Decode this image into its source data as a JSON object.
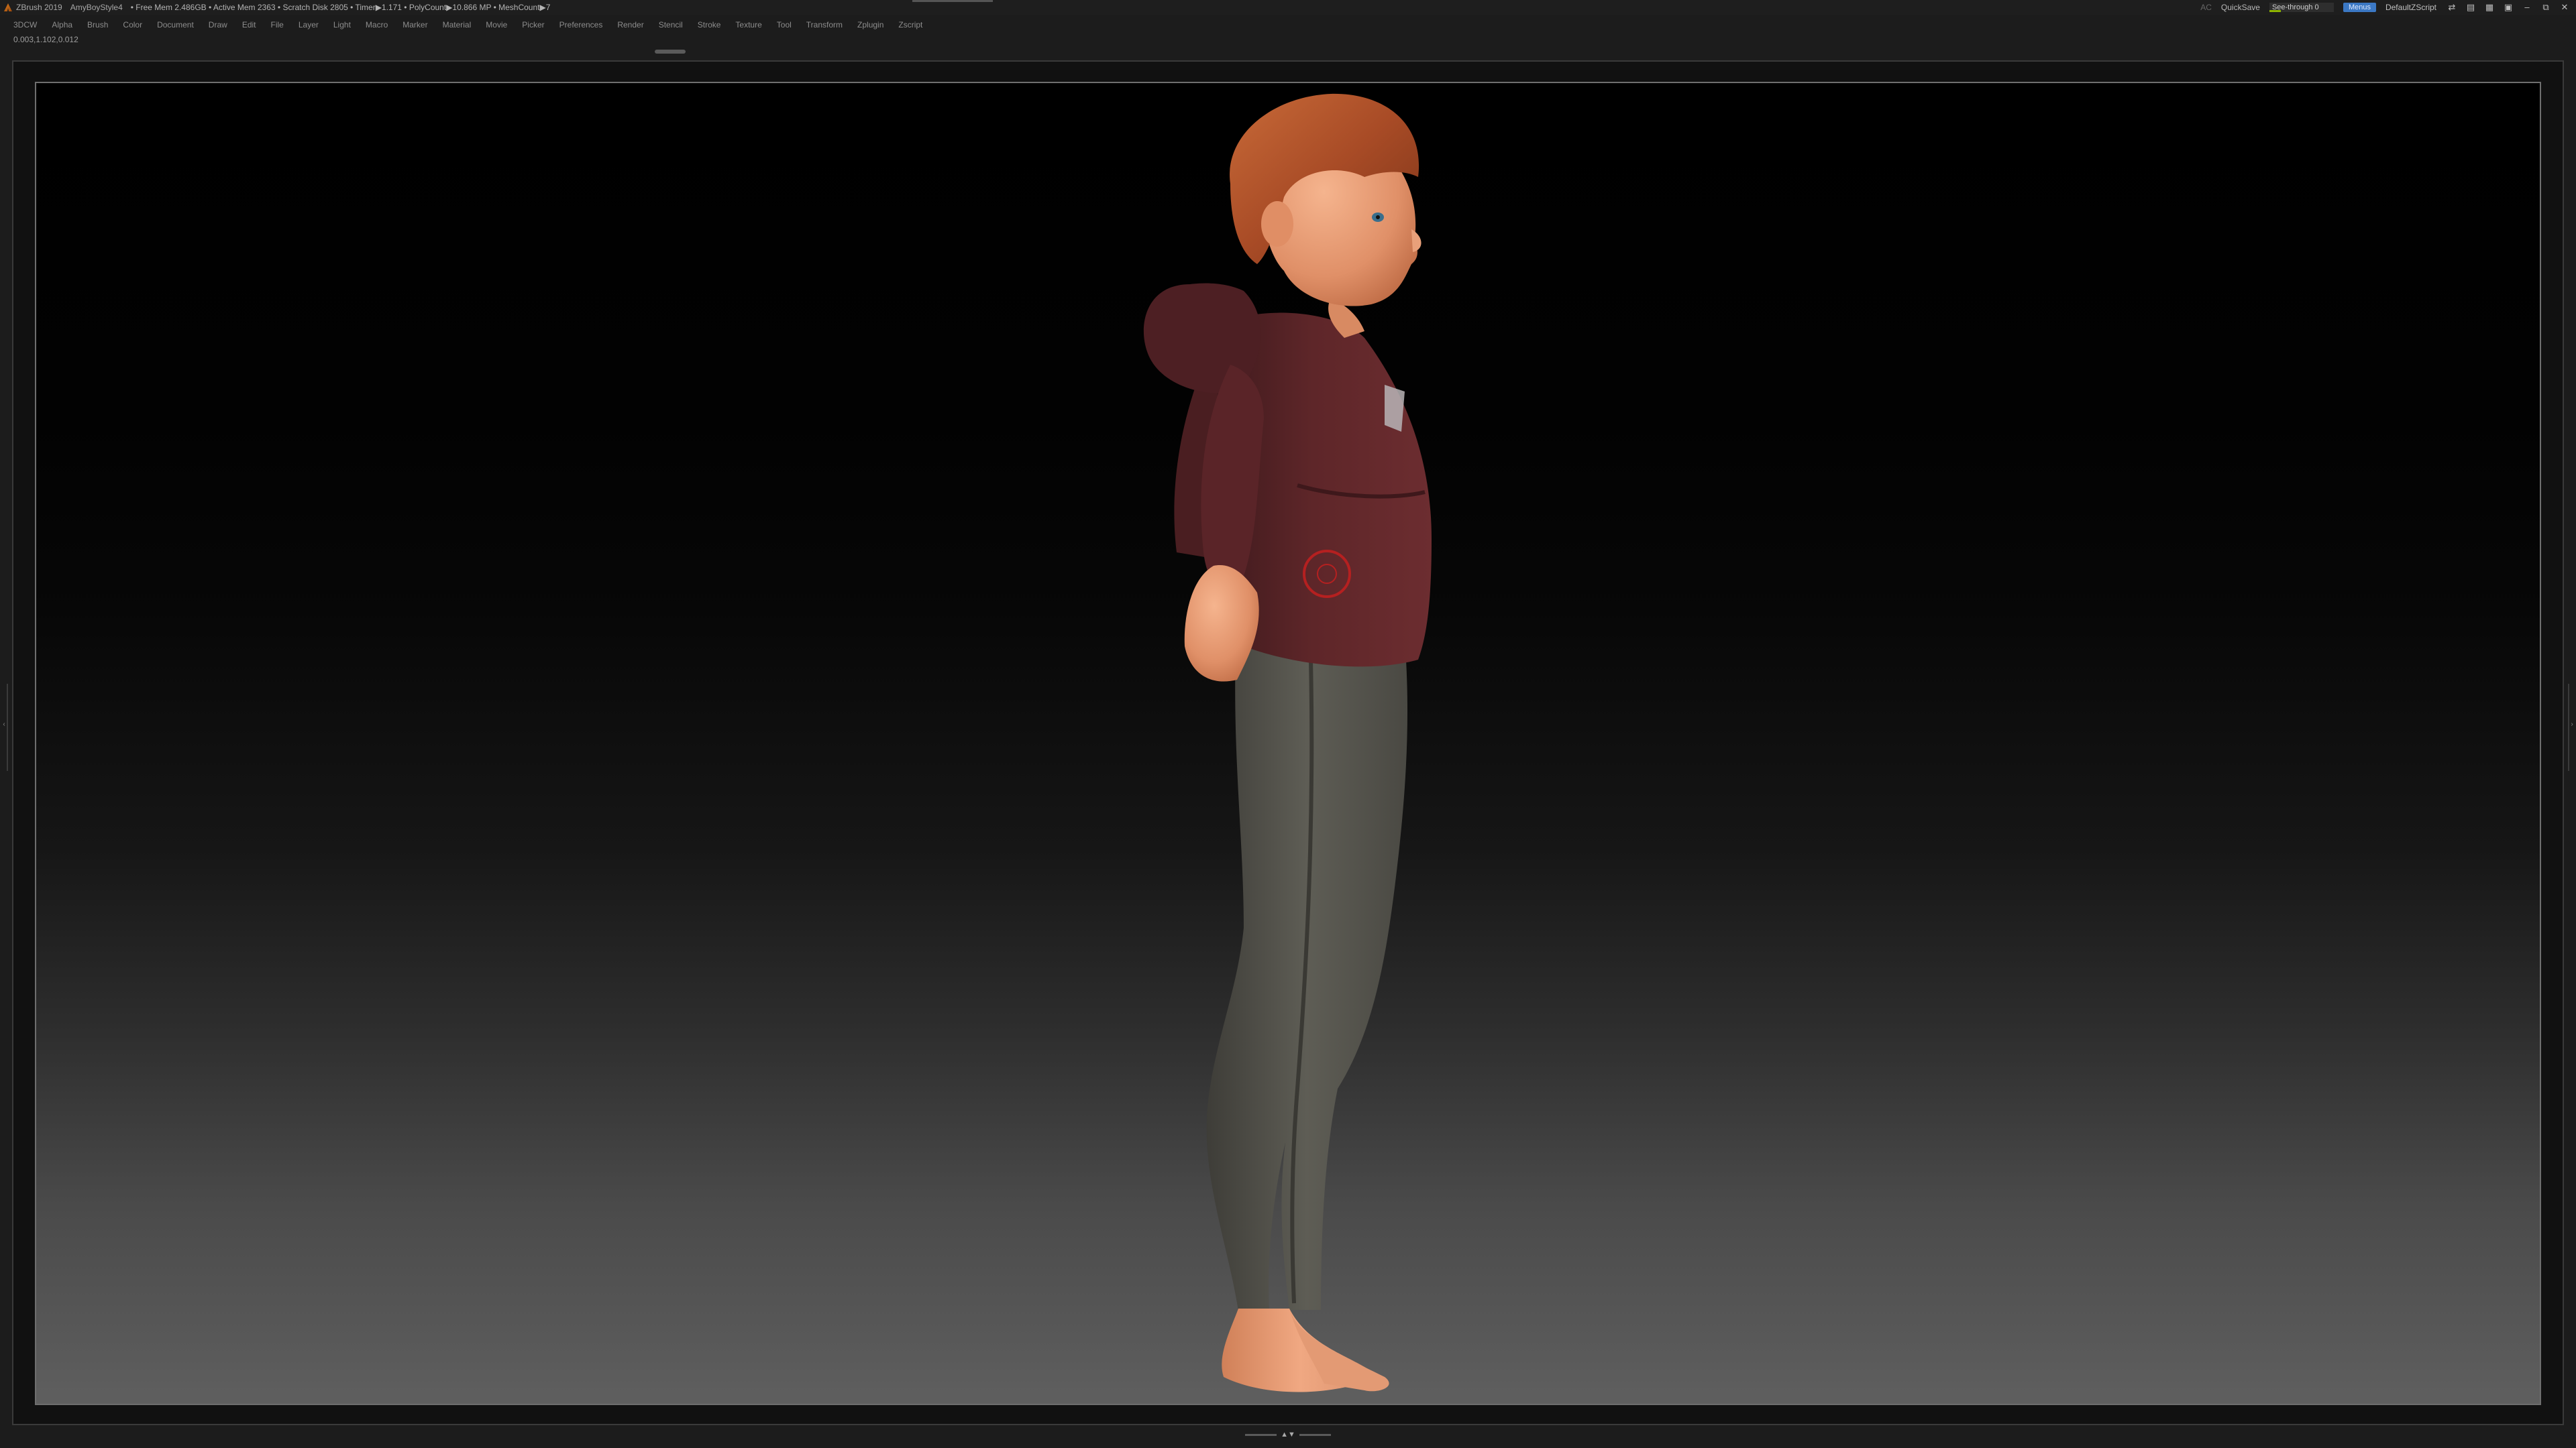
{
  "titlebar": {
    "app": "ZBrush 2019",
    "document": "AmyBoyStyle4",
    "stats": "• Free Mem 2.486GB • Active Mem 2363 • Scratch Disk 2805 • Timer▶1.171 • PolyCount▶10.866 MP • MeshCount▶7",
    "ac": "AC",
    "quicksave": "QuickSave",
    "see_through_label": "See-through",
    "see_through_value": "0",
    "see_through_level": 0.0,
    "menus": "Menus",
    "zscript": "DefaultZScript"
  },
  "menubar": {
    "items": [
      "3DCW",
      "Alpha",
      "Brush",
      "Color",
      "Document",
      "Draw",
      "Edit",
      "File",
      "Layer",
      "Light",
      "Macro",
      "Marker",
      "Material",
      "Movie",
      "Picker",
      "Preferences",
      "Render",
      "Stencil",
      "Stroke",
      "Texture",
      "Tool",
      "Transform",
      "Zplugin",
      "Zscript"
    ]
  },
  "coords": "0.003,1.102,0.012",
  "colors": {
    "hoodie": "#5a2529",
    "skin": "#e8a07a",
    "hair": "#b4552d",
    "pants": "#585750",
    "accent_menus": "#3b78c4",
    "see_through_fill": "#8fb500"
  },
  "icons": [
    "zbrush-logo-icon",
    "dock-icon",
    "layout-icon",
    "lock-icon",
    "minimize-icon",
    "restore-icon",
    "close-icon"
  ]
}
